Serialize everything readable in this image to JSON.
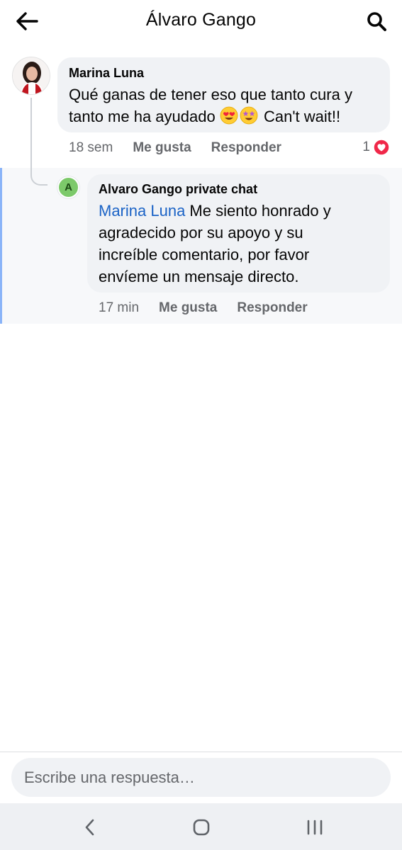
{
  "header": {
    "title": "Álvaro Gango"
  },
  "comment": {
    "author": "Marina Luna",
    "text_line1": "Qué ganas de tener eso que tanto cura y",
    "text_line2_pre": "tanto me ha  ayudado",
    "text_line2_post": "Can't wait!!",
    "emojis": [
      "heart-eyes-emoji",
      "star-struck-emoji"
    ],
    "time": "18 sem",
    "like_label": "Me gusta",
    "reply_label": "Responder",
    "reaction_count": "1",
    "reaction_icon": "heart-reaction-icon"
  },
  "reply": {
    "avatar_letter": "A",
    "avatar_color": "#7cc96a",
    "author": "Alvaro Gango private chat",
    "mention": "Marina Luna",
    "text_after_mention": " Me siento honrado y",
    "text_line2": "agradecido por su apoyo y su",
    "text_line3": "increíble comentario, por favor",
    "text_line4": "envíeme un mensaje directo.",
    "time": "17 min",
    "like_label": "Me gusta",
    "reply_label": "Responder"
  },
  "composer": {
    "placeholder": "Escribe una respuesta…"
  },
  "colors": {
    "mention": "#1b63c6",
    "bubble": "#f0f2f5",
    "reaction_heart": "#f02849",
    "highlight_bar": "#8ab4f8"
  }
}
